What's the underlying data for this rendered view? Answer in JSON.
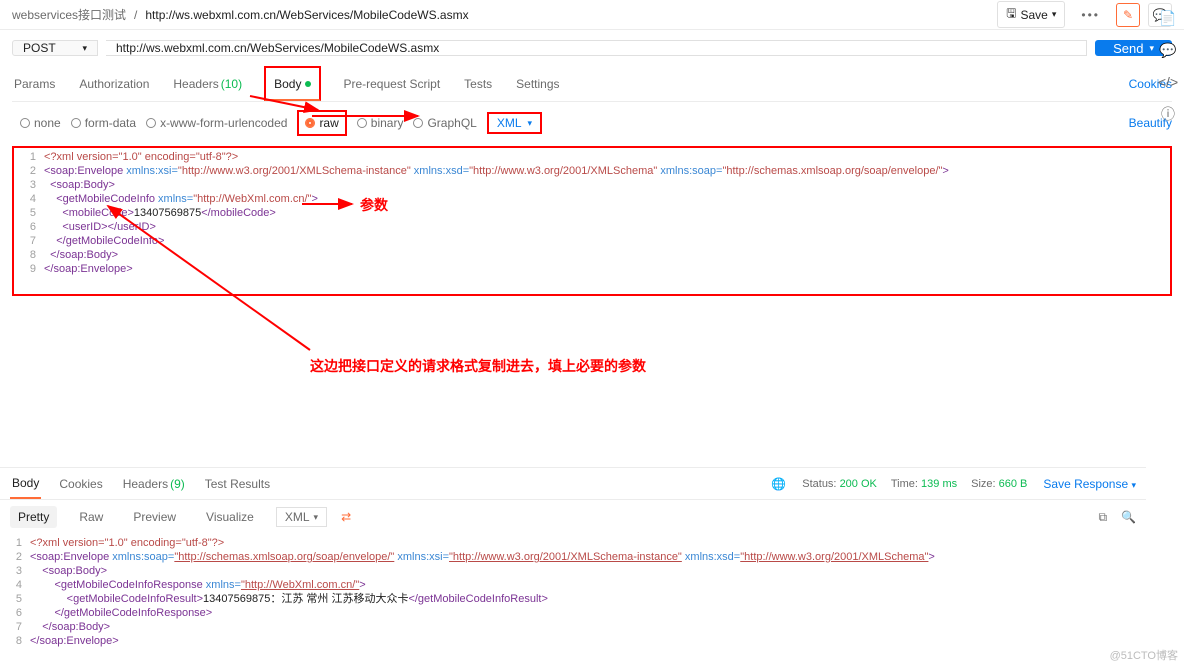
{
  "breadcrumb": {
    "collection": "webservices接口测试",
    "request": "http://ws.webxml.com.cn/WebServices/MobileCodeWS.asmx"
  },
  "topbar": {
    "save_label": "Save"
  },
  "request": {
    "method": "POST",
    "url": "http://ws.webxml.com.cn/WebServices/MobileCodeWS.asmx",
    "send_label": "Send"
  },
  "tabs": {
    "params": "Params",
    "auth": "Authorization",
    "headers": "Headers",
    "headers_count": "(10)",
    "body": "Body",
    "prerequest": "Pre-request Script",
    "tests": "Tests",
    "settings": "Settings",
    "cookies": "Cookies"
  },
  "body_radios": {
    "none": "none",
    "formdata": "form-data",
    "urlenc": "x-www-form-urlencoded",
    "raw": "raw",
    "binary": "binary",
    "graphql": "GraphQL"
  },
  "body_dd": {
    "xml": "XML"
  },
  "beautify": "Beautify",
  "req_code": {
    "l1_decl": "<?xml version=\"1.0\" encoding=\"utf-8\"?>",
    "l2_a": "<soap:Envelope",
    "l2_b": " xmlns:xsi=",
    "l2_c": "\"http://www.w3.org/2001/XMLSchema-instance\"",
    "l2_d": " xmlns:xsd=",
    "l2_e": "\"http://www.w3.org/2001/XMLSchema\"",
    "l2_f": " xmlns:soap=",
    "l2_g": "\"http://schemas.xmlsoap.org/soap/envelope/\"",
    "l2_h": ">",
    "l3": "  <soap:Body>",
    "l4_a": "    <getMobileCodeInfo",
    "l4_b": " xmlns=",
    "l4_c": "\"http://WebXml.com.cn/\"",
    "l4_d": ">",
    "l5_a": "      <mobileCode>",
    "l5_b": "13407569875",
    "l5_c": "</mobileCode>",
    "l6": "      <userID></userID>",
    "l7": "    </getMobileCodeInfo>",
    "l8": "  </soap:Body>",
    "l9": "</soap:Envelope>"
  },
  "annotations": {
    "param": "参数",
    "copybody": "这边把接口定义的请求格式复制进去，填上必要的参数"
  },
  "response": {
    "tabs": {
      "body": "Body",
      "cookies": "Cookies",
      "headers": "Headers",
      "headers_count": "(9)",
      "tests": "Test Results"
    },
    "status_label": "Status:",
    "status_value": "200 OK",
    "time_label": "Time:",
    "time_value": "139 ms",
    "size_label": "Size:",
    "size_value": "660 B",
    "save_response": "Save Response",
    "view": {
      "pretty": "Pretty",
      "raw": "Raw",
      "preview": "Preview",
      "visualize": "Visualize",
      "lang": "XML"
    }
  },
  "resp_code": {
    "l1_decl": "<?xml version=\"1.0\" encoding=\"utf-8\"?>",
    "l2_a": "<soap:Envelope",
    "l2_b": " xmlns:soap=",
    "l2_c": "\"http://schemas.xmlsoap.org/soap/envelope/\"",
    "l2_d": " xmlns:xsi=",
    "l2_e": "\"http://www.w3.org/2001/XMLSchema-instance\"",
    "l2_f": " xmlns:xsd=",
    "l2_g": "\"http://www.w3.org/2001/XMLSchema\"",
    "l2_h": ">",
    "l3": "    <soap:Body>",
    "l4_a": "        <getMobileCodeInfoResponse",
    "l4_b": " xmlns=",
    "l4_c": "\"http://WebXml.com.cn/\"",
    "l4_d": ">",
    "l5_a": "            <getMobileCodeInfoResult>",
    "l5_b": "13407569875：江苏 常州 江苏移动大众卡",
    "l5_c": "</getMobileCodeInfoResult>",
    "l6": "        </getMobileCodeInfoResponse>",
    "l7": "    </soap:Body>",
    "l8": "</soap:Envelope>"
  },
  "watermark": "@51CTO博客"
}
